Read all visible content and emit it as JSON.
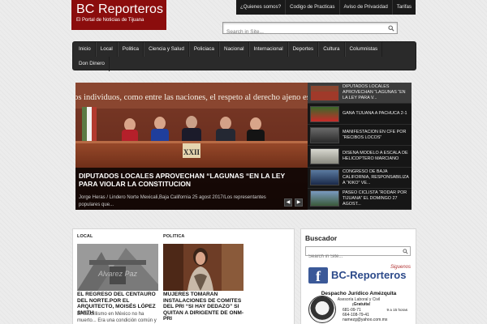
{
  "header": {
    "logo_title": "BC Reporteros",
    "logo_tagline": "El Portal de Noticias de Tijuana",
    "top_links": [
      "¿Quienes somos?",
      "Codigo de Practicas",
      "Aviso de Privacidad",
      "Tarifas"
    ],
    "search_placeholder": "Search in Site...",
    "nav_row1": [
      "Inicio",
      "Local",
      "Politica",
      "Ciencia y Salud",
      "Policiaca",
      "Nacional",
      "Internacional",
      "Deportes",
      "Cultura",
      "Columnistas"
    ],
    "nav_row2": [
      "Don Dinero"
    ]
  },
  "featured": {
    "banner_text": "\"Entre los individuos, como entre las naciones, el respeto al derecho ajeno es la paz\"",
    "podium_text": "XXII",
    "title": "DIPUTADOS LOCALES APROVECHAN “LAGUNAS “EN LA LEY PARA VIOLAR LA CONSTITUCION",
    "excerpt": "Jorge Heras / Lindero Norte Mexicali,Baja California 25 agost 2017/Los representantes populares que...",
    "prev_symbol": "◀",
    "next_symbol": "▶"
  },
  "slider_list": [
    {
      "text": "DIPUTADOS LOCALES APROVECHAN “LAGUNAS “EN LA LEY PARA V...",
      "active": true
    },
    {
      "text": "GANA TIJUANA A PACHUCA 2-1",
      "active": false
    },
    {
      "text": "MANIFESTACION EN CFE POR “RECIBOS LOCOS”",
      "active": false
    },
    {
      "text": "DISEÑA MODELO A ESCALA DE HELICOPTERO MARCIANO",
      "active": false
    },
    {
      "text": "CONGRESO DE BAJA CALIFORNIA, RESPONSABILIZA A “KIKO” VE...",
      "active": false
    },
    {
      "text": "PASEO CICLISTA “RODAR POR TIJUANA” EL DOMINGO 27 AGOST...",
      "active": false
    }
  ],
  "columns": [
    {
      "head": "LOCAL",
      "image_watermark": "Alvarez Paz",
      "title": "EL REGRESO DEL CENTAURO DEL NORTE.Por el Arquitecto, Moisés López Smith",
      "excerpt": "El caudillismo en México no ha muerto... Era una condición común y"
    },
    {
      "head": "POLITICA",
      "title": "MUJERES TOMARAN INSTALACIONES DE COMITES DEL PRI “SI HAY DEDAZO” SI QUITAN A DIRIGENTE DE ONM-PRI",
      "excerpt": ""
    }
  ],
  "sidebar": {
    "search_head": "Buscador",
    "search_placeholder": "Search in Site...",
    "fb_letter": "f",
    "fb_text": "BC-Reporteros",
    "fb_tag": "Siguenos",
    "ad_title": "Despacho Jurídico Amézquita",
    "ad_sub": "Asesoría Laboral y Civil",
    "ad_free": "¡Gratuita!",
    "ad_phone1": "681-09-71",
    "ad_phone2": "664-108-79-41",
    "ad_email": "namezg@yahoo.com.mx",
    "ad_hours": "9 a 15 horas"
  },
  "colors": {
    "brand": "#8b0d0d",
    "nav": "#2a2a2a",
    "facebook": "#3b5998"
  }
}
